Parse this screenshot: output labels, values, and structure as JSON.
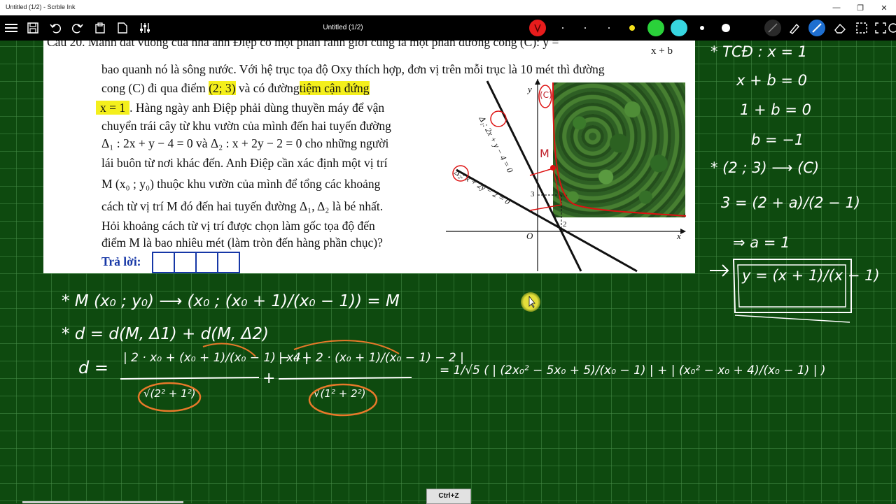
{
  "window": {
    "title": "Untitled (1/2) - Scrble Ink",
    "minimize": "—",
    "maximize": "❐",
    "close": "✕"
  },
  "toolbar": {
    "doc_title": "Untitled (1/2)",
    "pen_colors": [
      "#e81c1c",
      "#000000",
      "#000000",
      "#000000",
      "#f5e11b",
      "#2ad13a",
      "#37d6e0",
      "#ffffff",
      "#ffffff"
    ],
    "icons": [
      "menu-icon",
      "save-icon",
      "undo-icon",
      "redo-icon",
      "paste-icon",
      "new-page-icon",
      "settings-sliders-icon",
      "highlighter-icon",
      "pen-icon",
      "eraser-icon",
      "select-icon",
      "fullscreen-icon",
      "view-icon"
    ]
  },
  "problem": {
    "line0": "Câu 20. Mảnh đất vuông của nhà anh Điệp có một phần ranh giới cũng là một phần đường cong (C): y =",
    "frac_den": "x + b",
    "line1": "bao quanh nó là sông nước. Với hệ trục tọa độ Oxy thích hợp, đơn vị trên mỗi trục là 10 mét thì đường",
    "line2_a": "cong (C) đi qua điểm",
    "line2_b": "(2; 3)",
    "line2_c": "và có đường",
    "line2_d": "tiệm cận đứng",
    "line3_a": "x = 1",
    "line3_b": ". Hàng ngày anh Điệp phải dùng thuyền máy để vận",
    "line4": "chuyển trái cây từ khu vườn của mình đến hai tuyến đường",
    "line5": "Δ₁ : 2x + y − 4 = 0  và  Δ₂ : x + 2y − 2 = 0  cho những người",
    "line6": "lái buôn từ nơi khác đến. Anh Điệp cần xác định một vị trí",
    "line7": "M (x₀ ; y₀)  thuộc khu vườn của mình để tổng các khoảng",
    "line8": "cách từ vị trí M đó đến hai tuyến đường  Δ₁, Δ₂  là bé nhất.",
    "line9": "Hỏi khoảng cách từ vị trí được chọn làm gốc tọa độ đến",
    "line10": "điểm M là bao nhiêu mét (làm tròn đến hàng phần chục)?",
    "answer_label": "Trả lời:"
  },
  "figure": {
    "axis_y": "y",
    "axis_x": "x",
    "origin": "O",
    "tick_3": "3",
    "tick_2": "2",
    "curve_label": "(C)",
    "line1_label": "Δ₁: 2x + y − 4 = 0",
    "line2_label": "Δ₂: x + 2y − 2 = 0",
    "annot_M": "M",
    "annot_d1": "Δ₁",
    "annot_d2": "Δ₂"
  },
  "handwriting_right": [
    "* TCĐ : x = 1",
    "x + b = 0",
    "1 + b = 0",
    "b = −1",
    "* (2 ; 3) ⟶ (C)",
    "3 = (2 + a)/(2 − 1)",
    "⇒ a = 1",
    "y = (x + 1)/(x − 1)"
  ],
  "handwriting_bottom": {
    "l1": "* M (x₀ ; y₀)  ⟶  (x₀ ; (x₀ + 1)/(x₀ − 1)) = M",
    "l2": "* d = d(M, Δ1) + d(M, Δ2)",
    "l3_lhs": "d =",
    "l3_num1": "| 2 · x₀ + (x₀ + 1)/(x₀ − 1) − 4 |",
    "l3_den1": "√(2² + 1²)",
    "l3_num2": "| x₀ + 2 · (x₀ + 1)/(x₀ − 1) − 2 |",
    "l3_den2": "√(1² + 2²)",
    "l3_rhs": "= 1/√5 ( | (2x₀² − 5x₀ + 5)/(x₀ − 1) | + | (x₀² − x₀ + 4)/(x₀ − 1) | )"
  },
  "status": {
    "shortcut": "Ctrl+Z"
  }
}
